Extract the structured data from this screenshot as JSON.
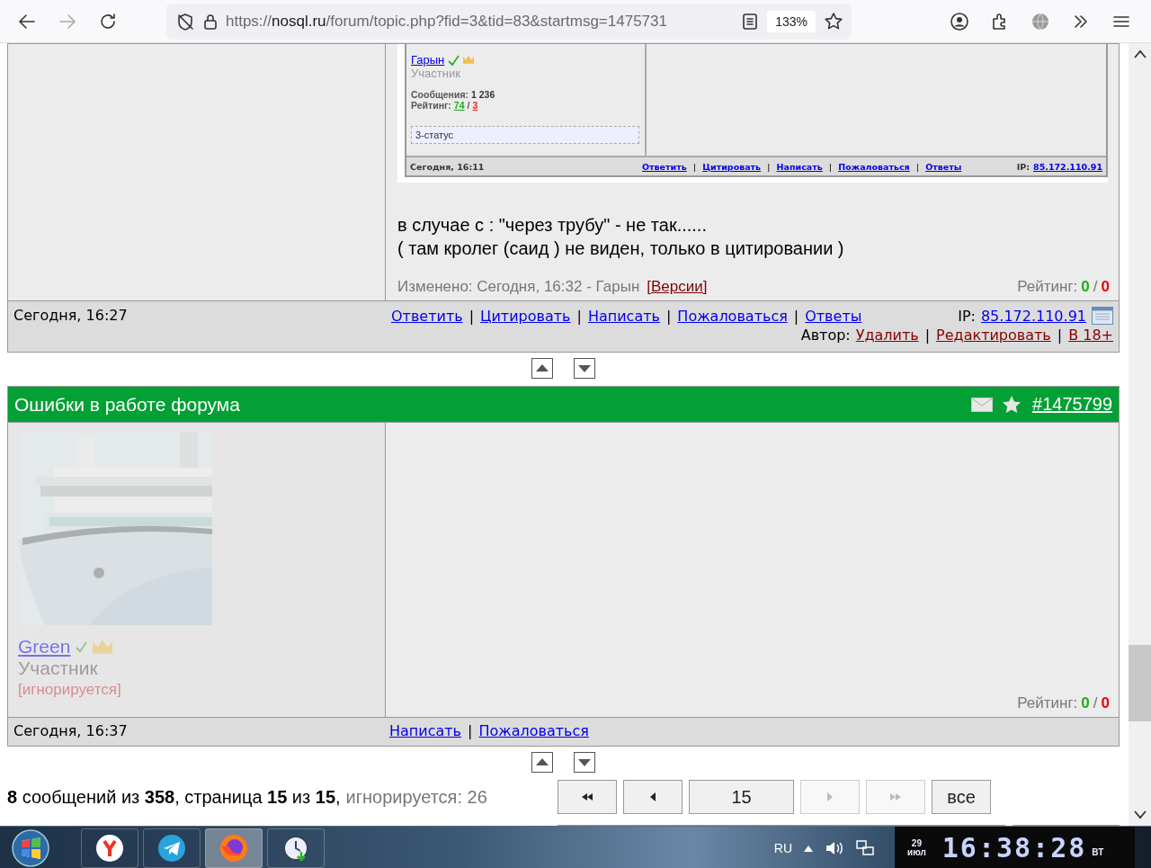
{
  "browser": {
    "url_scheme": "https://",
    "url_host": "nosql.ru",
    "url_path": "/forum/topic.php?fid=3&tid=83&startmsg=1475731",
    "zoom": "133%",
    "forward_disabled": true
  },
  "separator": "|",
  "post_top": {
    "quote_screenshot": {
      "author": "Гарын",
      "verified": true,
      "role": "Участник",
      "messages_label": "Сообщения:",
      "messages": "1 236",
      "rating_label": "Рейтинг:",
      "rating_plus": "74",
      "rating_separator": "/",
      "rating_minus": "3",
      "status": "3-статус",
      "date": "Сегодня, 16:11",
      "links": [
        "Ответить",
        "Цитировать",
        "Написать",
        "Пожаловаться",
        "Ответы"
      ],
      "ip_label": "IP:",
      "ip": "85.172.110.91"
    },
    "body_lines": [
      "в случае с : \"через трубу\" - не так......",
      "( там кролег (саид ) не виден, только в цитировании )"
    ],
    "edited": "Изменено: Сегодня, 16:32 - Гарын",
    "versions": "[Версии]",
    "rating_label": "Рейтинг:",
    "rating_plus": "0",
    "rating_separator": "/",
    "rating_minus": "0",
    "date": "Сегодня, 16:27",
    "links": [
      "Ответить",
      "Цитировать",
      "Написать",
      "Пожаловаться",
      "Ответы"
    ],
    "ip_label": "IP:",
    "ip": "85.172.110.91",
    "author_label": "Автор:",
    "author_links": [
      "Удалить",
      "Редактировать",
      "В 18+"
    ]
  },
  "post_bottom": {
    "title": "Ошибки в работе форума",
    "message_id": "#1475799",
    "author": "Green",
    "verified": true,
    "role": "Участник",
    "ignored": true,
    "ignored_label": "[игнорируется]",
    "rating_label": "Рейтинг:",
    "rating_plus": "0",
    "rating_separator": "/",
    "rating_minus": "0",
    "date": "Сегодня, 16:37",
    "links": [
      "Написать",
      "Пожаловаться"
    ]
  },
  "summary": {
    "text": "**8** сообщений из **358**, страница **15** из **15**,",
    "ignored": "игнорируется: 26"
  },
  "pagination": [
    {
      "kind": "first",
      "disabled": false
    },
    {
      "kind": "prev",
      "disabled": false
    },
    {
      "kind": "page",
      "label": "15",
      "disabled": false
    },
    {
      "kind": "next",
      "disabled": true
    },
    {
      "kind": "last",
      "disabled": true
    },
    {
      "kind": "all",
      "label": "все",
      "disabled": false
    }
  ],
  "taskbar": {
    "apps": [
      {
        "kind": "yandex",
        "selected": false
      },
      {
        "kind": "telegram",
        "selected": false
      },
      {
        "kind": "firefox",
        "selected": true
      },
      {
        "kind": "clock",
        "selected": false
      }
    ],
    "language": "RU",
    "day": "29",
    "month": "июл",
    "time": "16:38:28",
    "weekday": "ВТ"
  }
}
